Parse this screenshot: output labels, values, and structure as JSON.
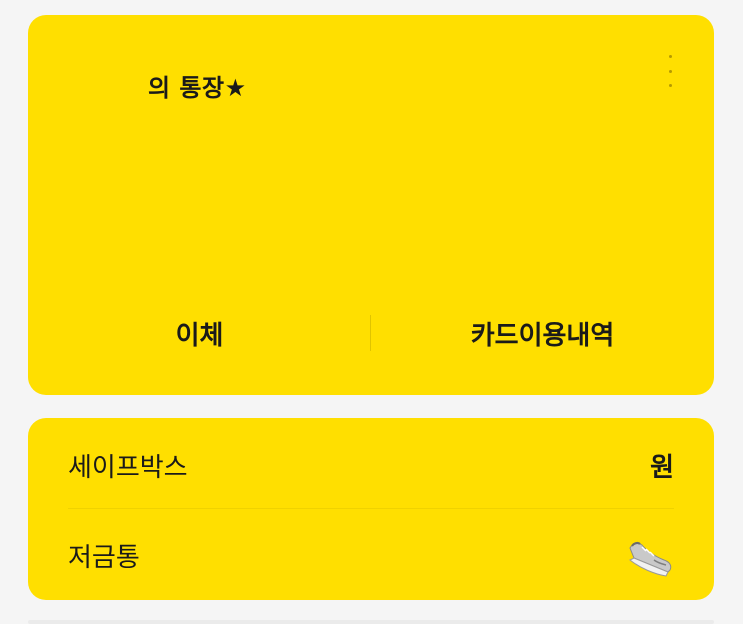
{
  "account": {
    "title": "의 통장★",
    "more_icon": "more-vertical-icon",
    "actions": {
      "transfer": "이체",
      "card_history": "카드이용내역"
    }
  },
  "sub_accounts": {
    "safebox": {
      "label": "세이프박스",
      "value": "원"
    },
    "piggybank": {
      "label": "저금통",
      "icon": "sneaker-icon"
    }
  },
  "colors": {
    "card_background": "#ffdf00",
    "page_background": "#f5f5f5",
    "text": "#1a1a1a"
  }
}
